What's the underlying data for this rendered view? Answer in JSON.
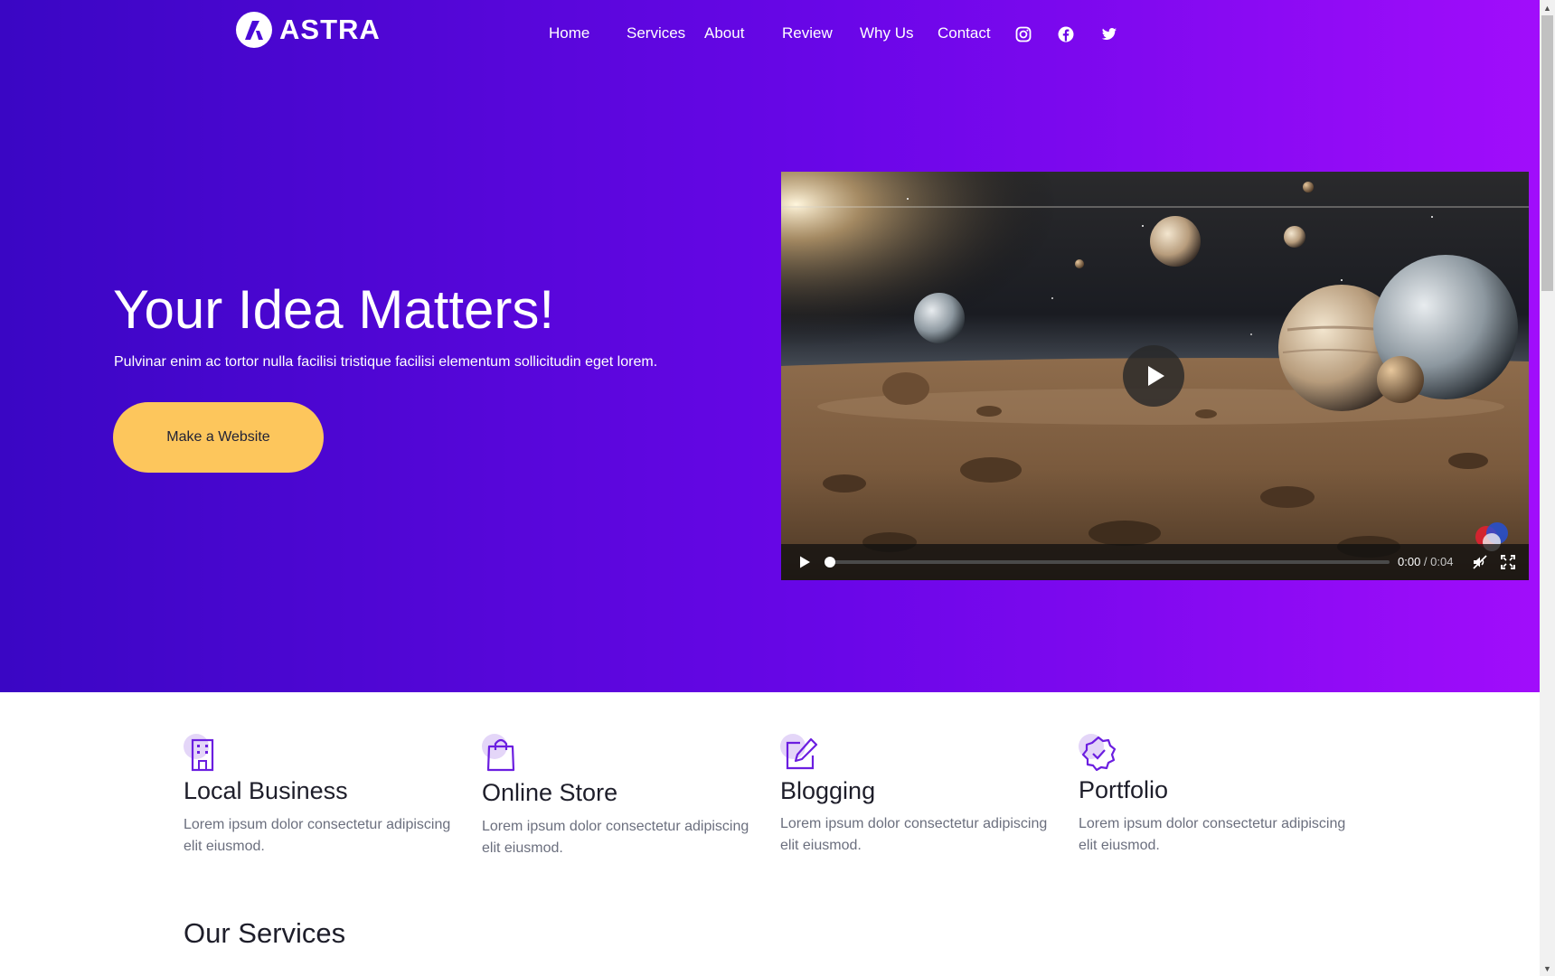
{
  "brand": {
    "name": "ASTRA"
  },
  "nav": {
    "items": [
      {
        "label": "Home"
      },
      {
        "label": "Services"
      },
      {
        "label": "About"
      },
      {
        "label": "Review"
      },
      {
        "label": "Why Us"
      },
      {
        "label": "Contact"
      }
    ],
    "social_icons": [
      "instagram-icon",
      "facebook-icon",
      "twitter-icon"
    ]
  },
  "hero": {
    "title": "Your Idea Matters!",
    "subtitle": "Pulvinar enim ac tortor nulla facilisi tristique facilisi elementum sollicitudin eget lorem.",
    "cta_label": "Make a Website"
  },
  "video": {
    "current_time": "0:00",
    "separator": " / ",
    "duration": "0:04",
    "progress": 0,
    "muted": true
  },
  "features": [
    {
      "icon": "building-icon",
      "title": "Local Business",
      "description": "Lorem ipsum dolor consectetur adipiscing elit eiusmod."
    },
    {
      "icon": "shopping-bag-icon",
      "title": "Online Store",
      "description": "Lorem ipsum dolor consectetur adipiscing elit eiusmod."
    },
    {
      "icon": "edit-icon",
      "title": "Blogging",
      "description": "Lorem ipsum dolor consectetur adipiscing elit eiusmod."
    },
    {
      "icon": "badge-check-icon",
      "title": "Portfolio",
      "description": "Lorem ipsum dolor consectetur adipiscing elit eiusmod."
    }
  ],
  "services": {
    "title": "Our Services"
  },
  "colors": {
    "hero_gradient_start": "#3a06c4",
    "hero_gradient_end": "#a10dfb",
    "cta_background": "#fdc65c",
    "icon_accent": "#6b1ee0",
    "icon_circle": "#e4d6f8"
  }
}
